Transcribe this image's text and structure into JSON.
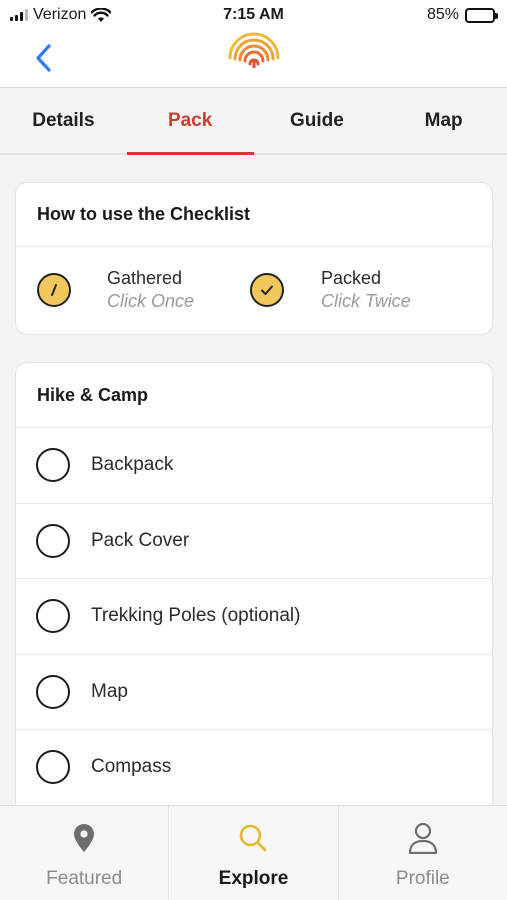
{
  "status_bar": {
    "carrier": "Verizon",
    "time": "7:15 AM",
    "battery": "85%",
    "battery_level": 0.85
  },
  "header": {
    "back_icon": "chevron-left-icon",
    "logo_icon": "fingerprint-logo"
  },
  "tabs": [
    {
      "label": "Details",
      "active": false
    },
    {
      "label": "Pack",
      "active": true
    },
    {
      "label": "Guide",
      "active": false
    },
    {
      "label": "Map",
      "active": false
    }
  ],
  "howto": {
    "title": "How to use the Checklist",
    "gathered": {
      "label": "Gathered",
      "hint": "Click Once",
      "icon": "slash-icon"
    },
    "packed": {
      "label": "Packed",
      "hint": "Click Twice",
      "icon": "checkmark-icon"
    }
  },
  "section": {
    "title": "Hike & Camp",
    "items": [
      {
        "label": "Backpack"
      },
      {
        "label": "Pack Cover"
      },
      {
        "label": "Trekking Poles (optional)"
      },
      {
        "label": "Map"
      },
      {
        "label": "Compass"
      }
    ]
  },
  "bottom_nav": [
    {
      "label": "Featured",
      "icon": "map-pin-icon",
      "active": false
    },
    {
      "label": "Explore",
      "icon": "search-icon",
      "active": true
    },
    {
      "label": "Profile",
      "icon": "person-icon",
      "active": false
    }
  ],
  "colors": {
    "accent_red": "#d23b34",
    "accent_yellow": "#f2c75b",
    "explore_icon": "#e8b830"
  }
}
